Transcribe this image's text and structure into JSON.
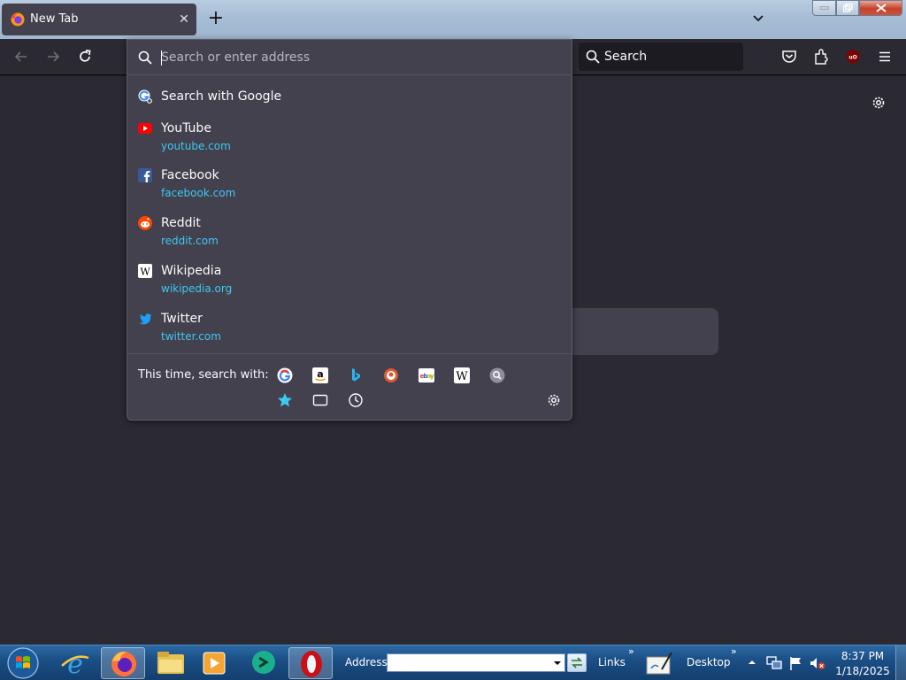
{
  "tab": {
    "title": "New Tab",
    "close_glyph": "✕",
    "icon": "firefox-icon"
  },
  "newtab_glyph": "+",
  "navbar": {
    "back_icon": "back-arrow-icon",
    "forward_icon": "forward-arrow-icon",
    "reload_icon": "reload-icon",
    "search_placeholder": "Search",
    "toolbar_icons": [
      "pocket-icon",
      "extensions-icon",
      "ublock-icon",
      "menu-icon"
    ]
  },
  "urlbar": {
    "placeholder": "Search or enter address",
    "search_with": "Search with Google",
    "suggestions": [
      {
        "name": "YouTube",
        "url": "youtube.com",
        "icon": "youtube-icon",
        "color": "#ff0000"
      },
      {
        "name": "Facebook",
        "url": "facebook.com",
        "icon": "facebook-icon",
        "color": "#3b5998"
      },
      {
        "name": "Reddit",
        "url": "reddit.com",
        "icon": "reddit-icon",
        "color": "#ff4500"
      },
      {
        "name": "Wikipedia",
        "url": "wikipedia.org",
        "icon": "wikipedia-icon",
        "color": "#ffffff"
      },
      {
        "name": "Twitter",
        "url": "twitter.com",
        "icon": "twitter-icon",
        "color": "#1da1f2"
      }
    ],
    "this_time_label": "This time, search with:",
    "engines": [
      "google-icon",
      "amazon-icon",
      "bing-icon",
      "duckduckgo-icon",
      "ebay-icon",
      "wikipedia-icon",
      "search-engine-icon"
    ],
    "modes": [
      "bookmarks-star-icon",
      "tabs-icon",
      "history-icon"
    ]
  },
  "taskbar": {
    "address_label": "Address",
    "links_label": "Links",
    "desktop_label": "Desktop",
    "chevron": "»",
    "time": "8:37 PM",
    "date": "1/18/2025",
    "apps": [
      "start-orb-icon",
      "internet-explorer-icon",
      "firefox-icon",
      "file-explorer-icon",
      "media-player-icon",
      "chat-app-icon",
      "opera-icon"
    ]
  },
  "colors": {
    "accent_link": "#3ec8f2",
    "panel_bg": "#42414d",
    "page_bg": "#2b2a33"
  }
}
